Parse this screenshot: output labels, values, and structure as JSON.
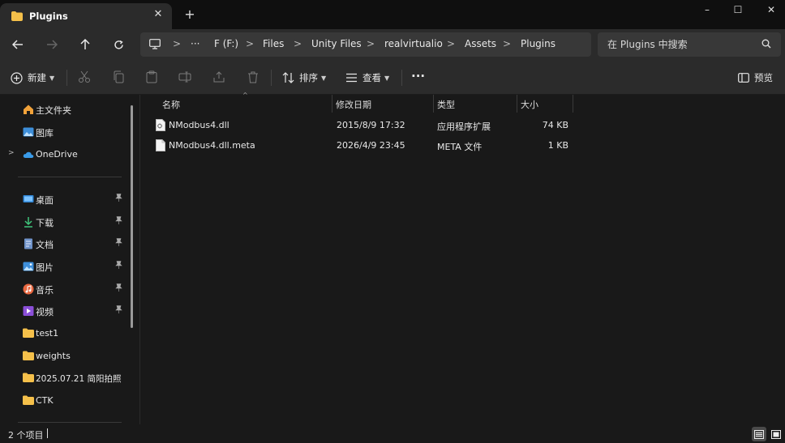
{
  "tab": {
    "title": "Plugins",
    "close": "✕",
    "new_tab": "+"
  },
  "window": {
    "minimize": "–",
    "maximize": "☐",
    "close": "✕"
  },
  "address": {
    "more": "···",
    "breadcrumbs": [
      "F (F:)",
      "Files",
      "Unity Files",
      "realvirtualio",
      "Assets",
      "Plugins"
    ],
    "separator": ">"
  },
  "search": {
    "placeholder": "在 Plugins 中搜索"
  },
  "toolbar": {
    "new_label": "新建",
    "sort_label": "排序",
    "view_label": "查看",
    "more": "···",
    "preview_label": "预览"
  },
  "sidebar": {
    "top_items": [
      {
        "label": "主文件夹",
        "icon": "home-icon"
      },
      {
        "label": "图库",
        "icon": "gallery-icon"
      },
      {
        "label": "OneDrive",
        "icon": "cloud-icon"
      }
    ],
    "pinned_items": [
      {
        "label": "桌面",
        "icon": "desktop-icon"
      },
      {
        "label": "下载",
        "icon": "download-icon"
      },
      {
        "label": "文档",
        "icon": "document-icon"
      },
      {
        "label": "图片",
        "icon": "pictures-icon"
      },
      {
        "label": "音乐",
        "icon": "music-icon"
      },
      {
        "label": "视频",
        "icon": "video-icon"
      }
    ],
    "folders": [
      {
        "label": "test1"
      },
      {
        "label": "weights"
      },
      {
        "label": "2025.07.21 简阳拍照"
      },
      {
        "label": "CTK"
      }
    ],
    "pin_glyph": "📌",
    "expand_glyph": ">"
  },
  "columns": {
    "name": "名称",
    "modified": "修改日期",
    "type": "类型",
    "size": "大小"
  },
  "files": [
    {
      "name": "NModbus4.dll",
      "modified": "2015/8/9 17:32",
      "type": "应用程序扩展",
      "size": "74 KB",
      "icon": "dll-file-icon"
    },
    {
      "name": "NModbus4.dll.meta",
      "modified": "2026/4/9 23:45",
      "type": "META 文件",
      "size": "1 KB",
      "icon": "file-icon"
    }
  ],
  "status": {
    "count": "2 个项目"
  },
  "colors": {
    "folder": "#f5c04a",
    "accent": "#4aa3f0",
    "bg": "#191919",
    "chrome": "#2b2b2b"
  }
}
